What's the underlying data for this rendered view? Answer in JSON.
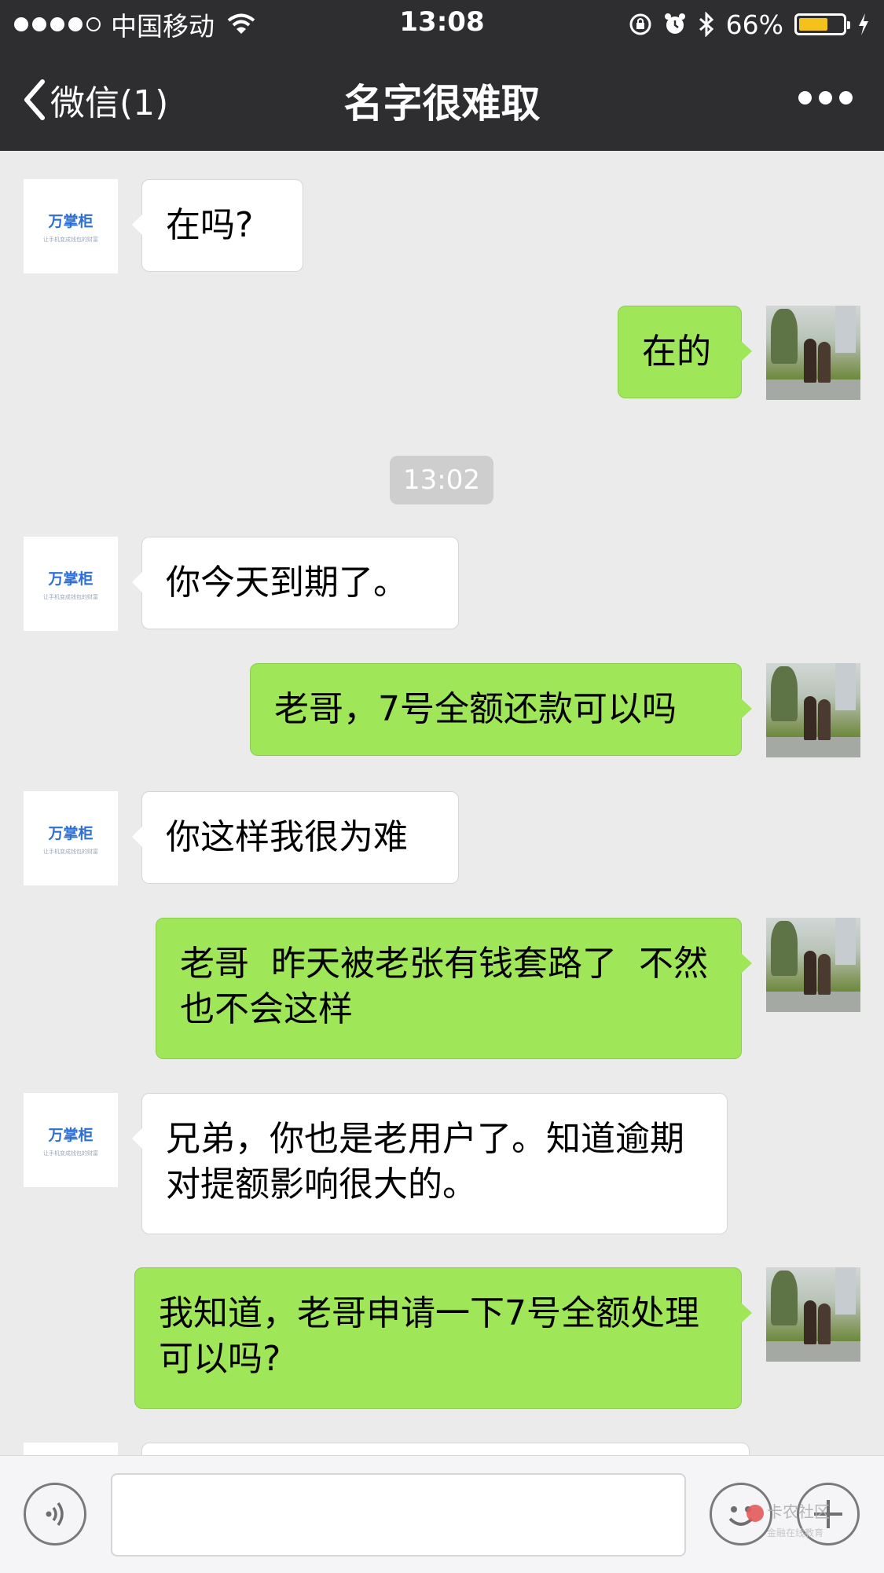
{
  "status_bar": {
    "carrier": "中国移动",
    "time": "13:08",
    "battery_percent": "66%",
    "battery_level": 0.66,
    "signal_bars_filled": 4,
    "battery_color": "#f5c21b"
  },
  "nav": {
    "back_label": "微信(1)",
    "title": "名字很难取"
  },
  "contact_avatar": {
    "brand": "万掌柜",
    "tagline": "让手机变成钱包的财富"
  },
  "messages": [
    {
      "side": "left",
      "text": "在吗?"
    },
    {
      "side": "right",
      "text": "在的"
    },
    {
      "side": "left",
      "text": "你今天到期了。"
    },
    {
      "side": "right",
      "text": "老哥，7号全额还款可以吗"
    },
    {
      "side": "left",
      "text": "你这样我很为难"
    },
    {
      "side": "right",
      "text": "老哥  昨天被老张有钱套路了  不然也不会这样"
    },
    {
      "side": "left",
      "text": "兄弟，你也是老用户了。知道逾期对提额影响很大的。"
    },
    {
      "side": "right",
      "text": "我知道，老哥申请一下7号全额处理可以吗?"
    }
  ],
  "timestamp": "13:02",
  "watermark": {
    "title": "卡农社区",
    "subtitle": "金融在线教育"
  },
  "colors": {
    "bar_bg": "#2e2e31",
    "chat_bg": "#ebebeb",
    "bubble_self": "#9fe659",
    "bubble_other": "#ffffff"
  }
}
